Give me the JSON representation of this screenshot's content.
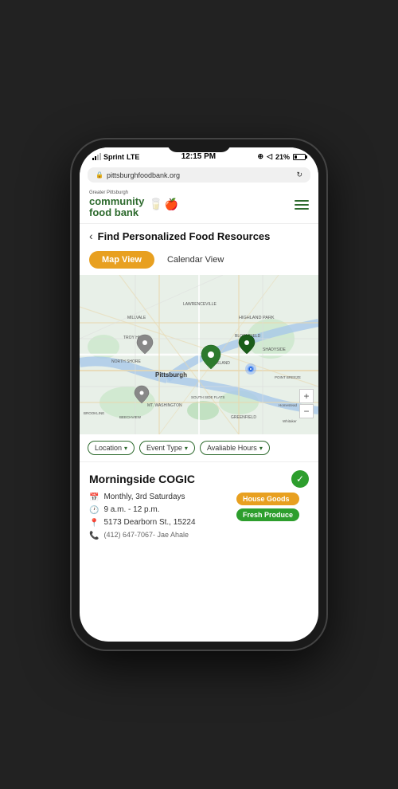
{
  "status_bar": {
    "carrier": "Sprint",
    "network": "LTE",
    "time": "12:15 PM",
    "battery": "21%"
  },
  "address_bar": {
    "url": "pittsburghfoodbank.org"
  },
  "header": {
    "logo_greater": "Greater Pittsburgh",
    "logo_line1": "community",
    "logo_line2": "food bank",
    "menu_icon": "≡"
  },
  "page_title": "Find Personalized Food Resources",
  "view_toggle": {
    "map_view": "Map View",
    "calendar_view": "Calendar View"
  },
  "filters": {
    "location": "Location",
    "event_type": "Event Type",
    "available_hours": "Avaliable Hours"
  },
  "result": {
    "name": "Morningside COGIC",
    "schedule": "Monthly, 3rd Saturdays",
    "hours": "9 a.m. - 12 p.m.",
    "address": "5173 Dearborn St., 15224",
    "phone": "(412) 647-7067- Jae Ahale",
    "tags": {
      "house_goods": "House Goods",
      "fresh_produce": "Fresh Produce"
    }
  },
  "map_controls": {
    "zoom_in": "+",
    "zoom_out": "−"
  }
}
